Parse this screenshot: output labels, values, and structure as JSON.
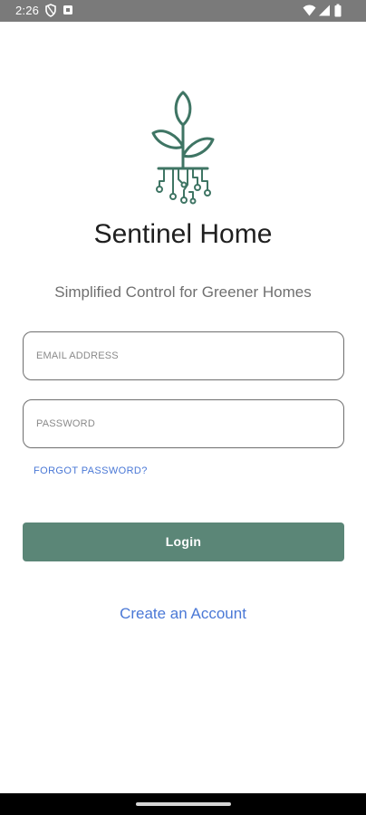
{
  "status_bar": {
    "time": "2:26",
    "left_icons": [
      "shield-icon",
      "notification-icon"
    ],
    "right_icons": [
      "wifi-icon",
      "signal-icon",
      "battery-icon"
    ]
  },
  "app": {
    "logo_icon": "plant-circuit-logo",
    "title": "Sentinel Home",
    "tagline": "Simplified Control for Greener Homes"
  },
  "form": {
    "email_placeholder": "EMAIL ADDRESS",
    "email_value": "",
    "password_placeholder": "PASSWORD",
    "password_value": "",
    "forgot_password_label": "FORGOT PASSWORD?",
    "login_label": "Login",
    "create_account_label": "Create an Account"
  },
  "colors": {
    "brand_green": "#5b8677",
    "logo_green": "#3f7564",
    "link_blue": "#4a78d6",
    "status_bar": "#7a7a7a"
  }
}
